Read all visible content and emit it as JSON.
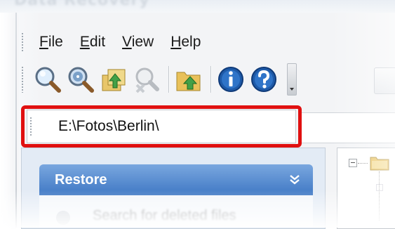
{
  "window": {
    "title": "Data Recovery"
  },
  "menu": {
    "items": [
      {
        "label": "File",
        "accel": "F",
        "rest": "ile"
      },
      {
        "label": "Edit",
        "accel": "E",
        "rest": "dit"
      },
      {
        "label": "View",
        "accel": "V",
        "rest": "iew"
      },
      {
        "label": "Help",
        "accel": "H",
        "rest": "elp"
      }
    ]
  },
  "toolbar": {
    "buttons": [
      {
        "name": "search-icon"
      },
      {
        "name": "deep-search-icon"
      },
      {
        "name": "recover-files-icon"
      },
      {
        "name": "search-disabled-icon"
      },
      {
        "name": "folder-up-icon"
      },
      {
        "name": "info-icon"
      },
      {
        "name": "help-icon"
      }
    ]
  },
  "address": {
    "value": "E:\\Fotos\\Berlin\\",
    "highlight_color": "#e01010"
  },
  "restore_panel": {
    "title": "Restore",
    "item": "Search for deleted files"
  },
  "colors": {
    "panel_header": "#3f78c4",
    "panel_bg": "#e3ebf5"
  }
}
